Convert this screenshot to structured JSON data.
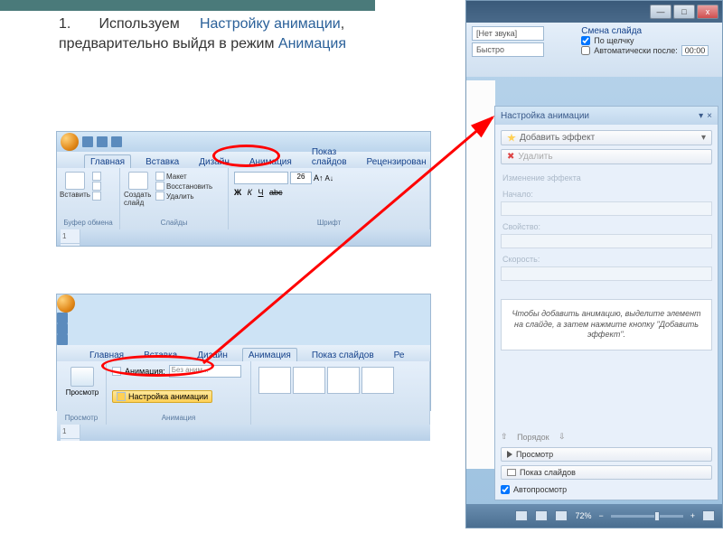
{
  "instruction": {
    "num": "1.",
    "text1": "Используем",
    "link1": "Настройку анимации",
    "text2": ", предварительно выйдя в режим",
    "link2": "Анимация"
  },
  "shot1": {
    "tabs": [
      "Главная",
      "Вставка",
      "Дизайн",
      "Анимация",
      "Показ слайдов",
      "Рецензирован"
    ],
    "paste": "Вставить",
    "clipboard_group": "Буфер обмена",
    "new_slide": "Создать слайд",
    "layout": "Макет",
    "reset": "Восстановить",
    "delete": "Удалить",
    "slides_group": "Слайды",
    "font_group": "Шрифт",
    "font_size": "26",
    "thumb_num": "1"
  },
  "shot2": {
    "tabs": [
      "Главная",
      "Вставка",
      "Дизайн",
      "Анимация",
      "Показ слайдов",
      "Ре"
    ],
    "preview": "Просмотр",
    "preview_group": "Просмотр",
    "anim_label": "Анимация:",
    "anim_value": "Без аним...",
    "custom_anim": "Настройка анимации",
    "anim_group": "Анимация",
    "thumb_num": "1"
  },
  "shot3": {
    "sound_field": "[Нет звука]",
    "speed_field": "Быстро",
    "transition_label": "Смена слайда",
    "on_click": "По щелчку",
    "auto_after": "Автоматически после:",
    "auto_time": "00:00",
    "pane_title": "Настройка анимации",
    "add_effect": "Добавить эффект",
    "remove": "Удалить",
    "change_effect": "Изменение эффекта",
    "start_label": "Начало:",
    "property_label": "Свойство:",
    "speed_label": "Скорость:",
    "hint": "Чтобы добавить анимацию, выделите элемент на слайде, а затем нажмите кнопку \"Добавить эффект\".",
    "order": "Порядок",
    "play": "Просмотр",
    "slideshow": "Показ слайдов",
    "autopreview": "Автопросмотр",
    "zoom": "72%"
  }
}
